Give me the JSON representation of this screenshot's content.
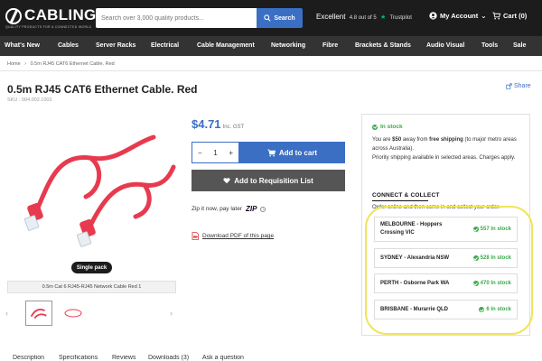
{
  "header": {
    "logo_text": "CABLING",
    "logo_tagline": "QUALITY PRODUCTS FOR A CONNECTED WORLD",
    "search_placeholder": "Search over 3,000 quality products...",
    "search_button": "Search",
    "trust_rating_label": "Excellent",
    "trust_score": "4.8 out of 5",
    "trust_brand": "Trustpilot",
    "account_label": "My Account",
    "cart_label": "Cart (0)"
  },
  "nav": {
    "items": [
      "What's New",
      "Cables",
      "Server Racks",
      "Electrical",
      "Cable Management",
      "Networking",
      "Fibre",
      "Brackets & Stands",
      "Audio Visual",
      "Tools",
      "Sale"
    ]
  },
  "breadcrumb": {
    "home": "Home",
    "current": "0.5m RJ45 CAT6 Ethernet Cable. Red"
  },
  "product": {
    "title": "0.5m RJ45 CAT6 Ethernet Cable. Red",
    "sku": "SKU : 004.002.1002",
    "share_label": "Share",
    "badge": "Single pack",
    "caption": "0.5m Cat 6 RJ45-RJ45 Network Cable Red 1",
    "price": "$4.71",
    "price_note": "Inc. GST",
    "qty_minus": "−",
    "qty_value": "1",
    "qty_plus": "+",
    "add_to_cart": "Add to cart",
    "add_to_requisition": "Add to Requisition List",
    "zip_text": "Zip it now, pay later",
    "zip_logo": "ZIP",
    "pdf_link": "Download PDF of this page",
    "thumb_prev": "‹",
    "thumb_next": "›"
  },
  "stock": {
    "status": "In stock",
    "ship_part1": "You are ",
    "ship_amount": "$50",
    "ship_part2": " away from ",
    "ship_free": "free shipping",
    "ship_part3": " (to major metro areas across Australia).",
    "ship_line2": "Priority shipping available in selected areas. Charges apply.",
    "cc_title": "CONNECT & COLLECT",
    "cc_sub": "Order online and then come in and collect your order.",
    "stores": [
      {
        "name": "MELBOURNE - Hoppers Crossing VIC",
        "stock": "557 In stock"
      },
      {
        "name": "SYDNEY - Alexandria NSW",
        "stock": "528 In stock"
      },
      {
        "name": "PERTH - Osborne Park WA",
        "stock": "470 In stock"
      },
      {
        "name": "BRISBANE - Murarrie QLD",
        "stock": "6 In stock"
      }
    ]
  },
  "tabs": [
    "Description",
    "Specifications",
    "Reviews",
    "Downloads (3)",
    "Ask a question"
  ],
  "colors": {
    "accent": "#3a6fc4",
    "stock_green": "#3aa94a",
    "highlight": "#f0e55a",
    "cable_red": "#e83a4f"
  }
}
